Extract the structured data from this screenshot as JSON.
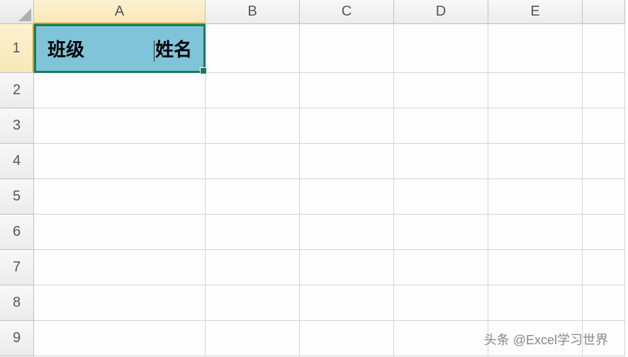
{
  "columns": [
    "A",
    "B",
    "C",
    "D",
    "E"
  ],
  "rows": [
    "1",
    "2",
    "3",
    "4",
    "5",
    "6",
    "7",
    "8",
    "9"
  ],
  "active_cell": {
    "row": 0,
    "col": 0,
    "content_left": "班级",
    "content_right": "姓名",
    "fill_color": "#7fc4d8",
    "border_color": "#1a7a5e"
  },
  "watermark": "头条 @Excel学习世界"
}
